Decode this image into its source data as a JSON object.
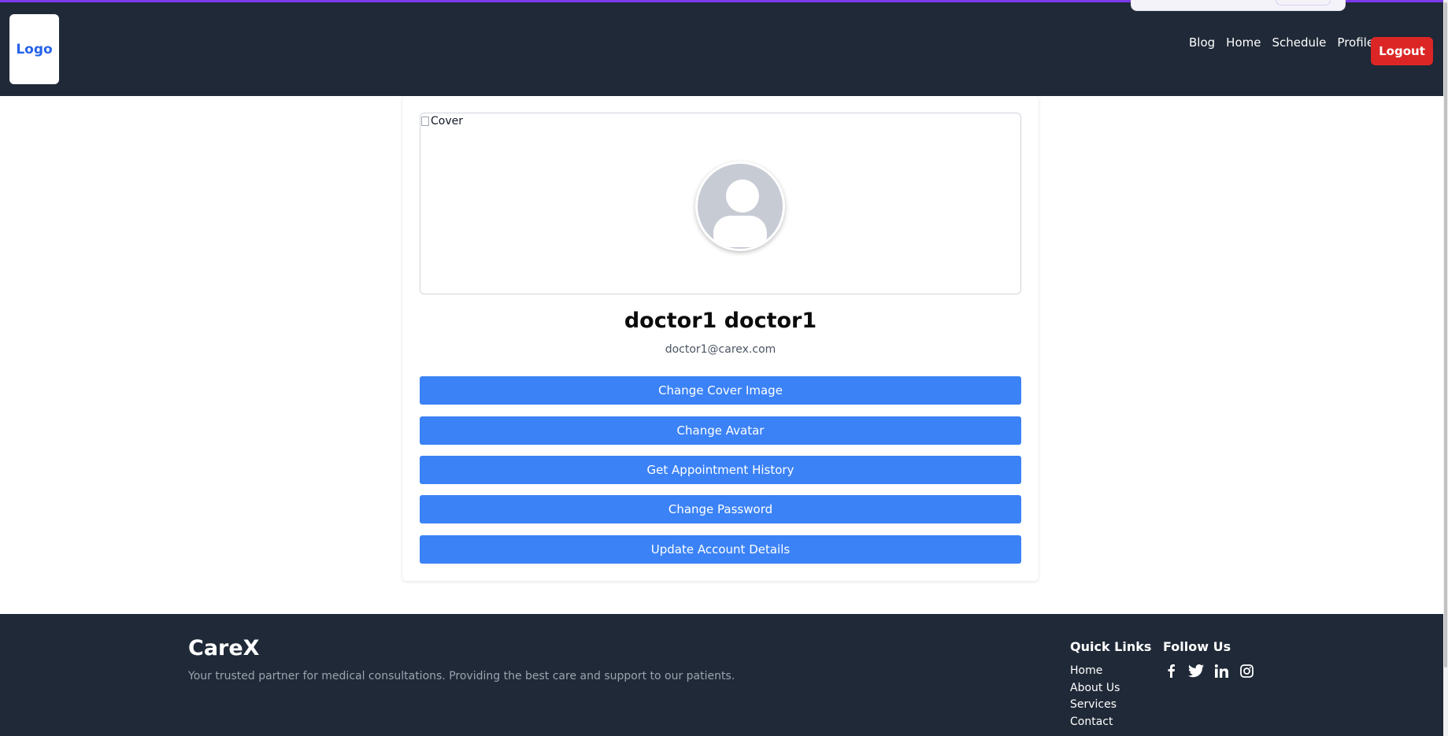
{
  "header": {
    "logo_text": "Logo",
    "nav": [
      {
        "label": "Blog"
      },
      {
        "label": "Home"
      },
      {
        "label": "Schedule"
      },
      {
        "label": "Profile"
      }
    ],
    "logout_label": "Logout"
  },
  "profile": {
    "cover_alt": "Cover",
    "name": "doctor1 doctor1",
    "email": "doctor1@carex.com",
    "actions": [
      {
        "label": "Change Cover Image"
      },
      {
        "label": "Change Avatar"
      },
      {
        "label": "Get Appointment History"
      },
      {
        "label": "Change Password"
      },
      {
        "label": "Update Account Details"
      }
    ]
  },
  "footer": {
    "brand": "CareX",
    "tagline": "Your trusted partner for medical consultations. Providing the best care and support to our patients.",
    "quick_links_title": "Quick Links",
    "quick_links": [
      {
        "label": "Home"
      },
      {
        "label": "About Us"
      },
      {
        "label": "Services"
      },
      {
        "label": "Contact"
      }
    ],
    "follow_title": "Follow Us",
    "social_icons": [
      "facebook-icon",
      "twitter-icon",
      "linkedin-icon",
      "instagram-icon"
    ]
  },
  "colors": {
    "navbar_bg": "#1f2937",
    "accent_blue": "#3b82f6",
    "logout_red": "#dc2626",
    "logo_blue": "#2563eb"
  }
}
